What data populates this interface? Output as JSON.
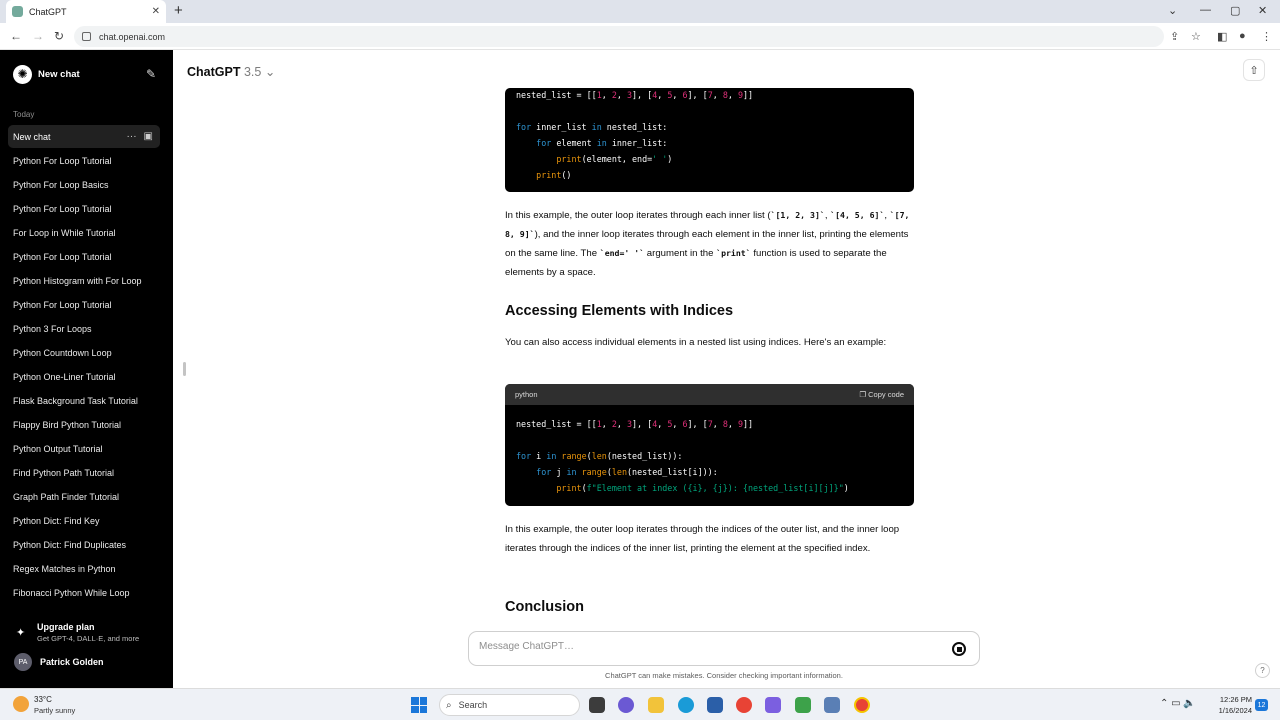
{
  "browser": {
    "tab_title": "ChatGPT",
    "tab_close": "✕",
    "new_tab": "+",
    "url": "chat.openai.com"
  },
  "sidebar": {
    "new_chat": "New chat",
    "section_today": "Today",
    "active_chat": "New chat",
    "items": [
      "Python For Loop Tutorial",
      "Python For Loop Basics",
      "Python For Loop Tutorial",
      "For Loop in While Tutorial",
      "Python For Loop Tutorial",
      "Python Histogram with For Loop",
      "Python For Loop Tutorial",
      "Python 3 For Loops",
      "Python Countdown Loop",
      "Python One-Liner Tutorial",
      "Flask Background Task Tutorial",
      "Flappy Bird Python Tutorial",
      "Python Output Tutorial",
      "Find Python Path Tutorial",
      "Graph Path Finder Tutorial",
      "Python Dict: Find Key",
      "Python Dict: Find Duplicates",
      "Regex Matches in Python",
      "Fibonacci Python While Loop"
    ],
    "upgrade_title": "Upgrade plan",
    "upgrade_sub": "Get GPT-4, DALL·E, and more",
    "user_initials": "PA",
    "user_name": "Patrick Golden"
  },
  "main": {
    "model_name": "ChatGPT",
    "model_version": "3.5",
    "para1": {
      "t1": "In this example, the outer loop iterates through each inner list (",
      "c1": "`[1, 2, 3]`",
      "t2": ", ",
      "c2": "`[4, 5, 6]`",
      "t3": ", ",
      "c3": "`[7, 8, 9]`",
      "t4": "), and the inner loop iterates through each element in the inner list, printing the elements on the same line. The ",
      "c4": "`end=' '`",
      "t5": " argument in the ",
      "c5": "`print`",
      "t6": " function is used to separate the elements by a space."
    },
    "heading1": "Accessing Elements with Indices",
    "para2": "You can also access individual elements in a nested list using indices. Here's an example:",
    "code2_lang": "python",
    "copy_code": "Copy code",
    "para3": "In this example, the outer loop iterates through the indices of the outer list, and the inner loop iterates through the indices of the inner list, printing the element at the specified index.",
    "heading2": "Conclusion",
    "composer_placeholder": "Message ChatGPT…",
    "disclaimer": "ChatGPT can make mistakes. Consider checking important information.",
    "help": "?"
  },
  "taskbar": {
    "weather_temp": "33°C",
    "weather_desc": "Partly sunny",
    "search": "Search",
    "time": "12:26 PM",
    "date": "1/16/2024",
    "notifications": "12"
  }
}
